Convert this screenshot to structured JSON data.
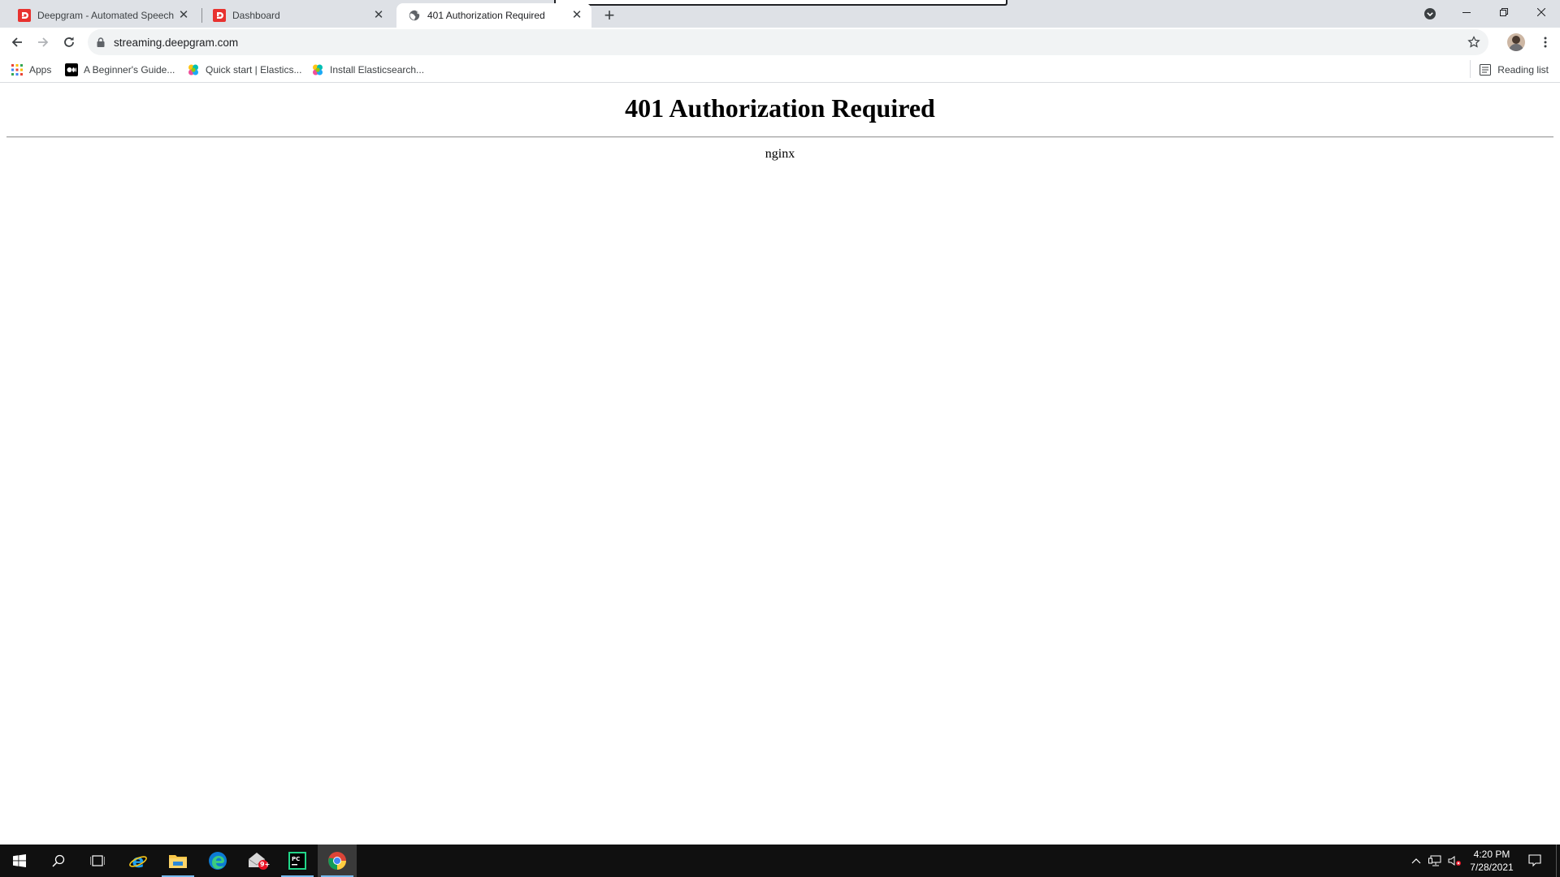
{
  "browser": {
    "tabs": [
      {
        "title": "Deepgram - Automated Speech R",
        "favicon": "deepgram-icon",
        "active": false
      },
      {
        "title": "Dashboard",
        "favicon": "deepgram-icon",
        "active": false
      },
      {
        "title": "401 Authorization Required",
        "favicon": "globe-icon",
        "active": true
      }
    ],
    "url": "streaming.deepgram.com",
    "bookmarks": [
      {
        "label": "Apps",
        "icon": "apps-grid-icon"
      },
      {
        "label": "A Beginner's Guide...",
        "icon": "medium-icon"
      },
      {
        "label": "Quick start | Elastics...",
        "icon": "elastic-icon"
      },
      {
        "label": "Install Elasticsearch...",
        "icon": "elastic-icon"
      }
    ],
    "reading_list_label": "Reading list",
    "accent_colors": {
      "tabstrip": "#dee1e6",
      "omnibox": "#f1f3f4",
      "deepgram_red": "#e8322f"
    }
  },
  "page": {
    "heading": "401 Authorization Required",
    "server": "nginx"
  },
  "taskbar": {
    "apps": [
      "start-icon",
      "search-icon",
      "task-view-icon",
      "internet-explorer-icon",
      "file-explorer-icon",
      "edge-icon",
      "mail-icon",
      "pycharm-icon",
      "chrome-icon"
    ],
    "mail_badge": "9+",
    "time": "4:20 PM",
    "date": "7/28/2021"
  }
}
